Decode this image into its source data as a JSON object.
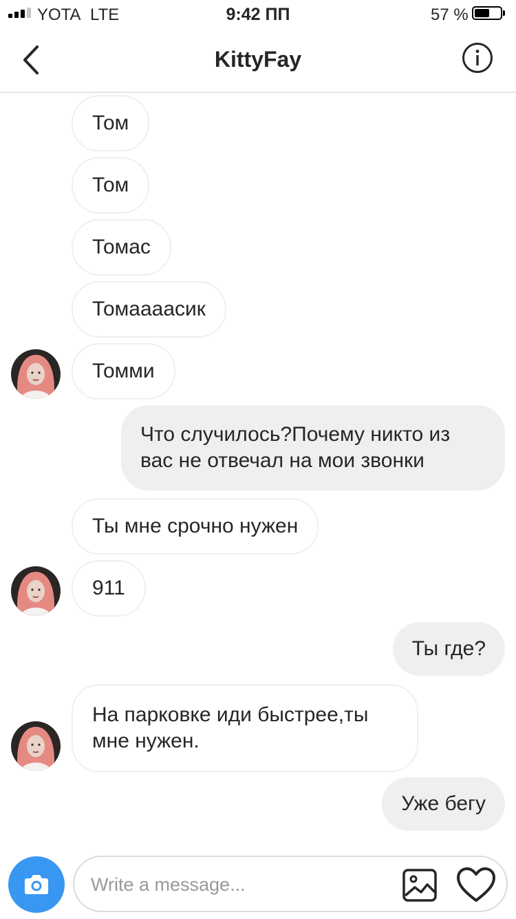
{
  "status_bar": {
    "carrier": "YOTA",
    "network": "LTE",
    "time": "9:42 ПП",
    "battery_percent_label": "57 %",
    "battery_level": 0.57,
    "signal_bars_active": 3,
    "signal_bars_total": 4
  },
  "header": {
    "back_icon": "chevron-left-icon",
    "title": "KittyFay",
    "info_icon": "info-icon"
  },
  "messages": [
    {
      "direction": "incoming",
      "text": "Том"
    },
    {
      "direction": "incoming",
      "text": "Том"
    },
    {
      "direction": "incoming",
      "text": "Томас"
    },
    {
      "direction": "incoming",
      "text": "Томаааасик"
    },
    {
      "direction": "incoming",
      "text": "Томми"
    },
    {
      "direction": "outgoing",
      "text": "Что случилось?Почему никто из вас не отвечал на мои звонки"
    },
    {
      "direction": "incoming",
      "text": "Ты мне срочно нужен"
    },
    {
      "direction": "incoming",
      "text": "911"
    },
    {
      "direction": "outgoing",
      "text": "Ты где?"
    },
    {
      "direction": "incoming",
      "text": "На парковке иди быстрее,ты мне нужен."
    },
    {
      "direction": "outgoing",
      "text": "Уже бегу"
    }
  ],
  "composer": {
    "camera_icon": "camera-icon",
    "placeholder": "Write a message...",
    "value": "",
    "gallery_icon": "image-icon",
    "like_icon": "heart-icon"
  },
  "colors": {
    "accent": "#3897f0",
    "outgoing_bubble": "#efefef",
    "incoming_border": "#efefef",
    "text": "#262626",
    "placeholder": "#999999"
  }
}
